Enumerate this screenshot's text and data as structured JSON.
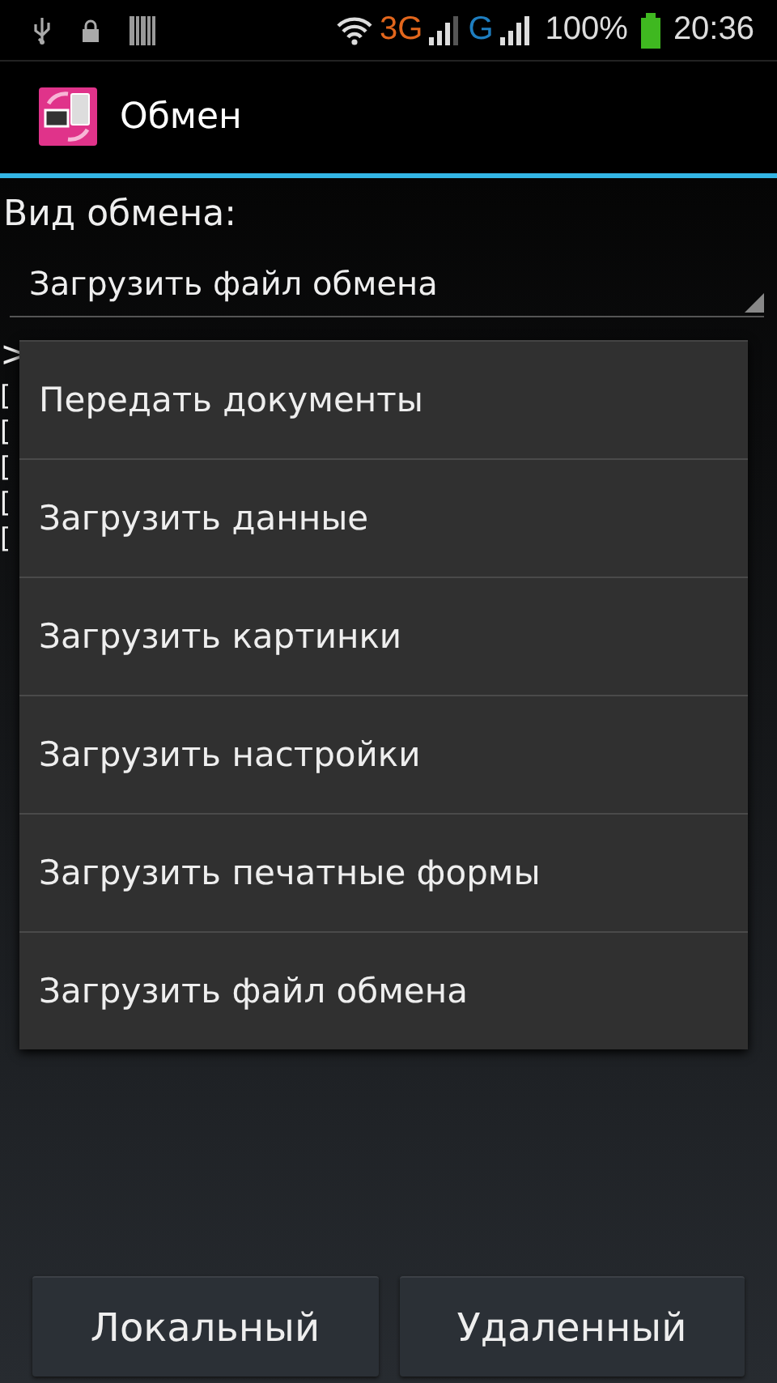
{
  "status_bar": {
    "network_3g": "3G",
    "network_g": "G",
    "battery_percent": "100%",
    "time": "20:36"
  },
  "action_bar": {
    "title": "Обмен"
  },
  "exchange_type": {
    "label": "Вид обмена:",
    "value": "Загрузить файл обмена"
  },
  "log": {
    "header": ">",
    "lines": [
      "[",
      "[",
      "[",
      "[",
      "["
    ]
  },
  "dropdown_menu": {
    "items": [
      {
        "label": "Передать документы"
      },
      {
        "label": "Загрузить данные"
      },
      {
        "label": "Загрузить картинки"
      },
      {
        "label": "Загрузить настройки"
      },
      {
        "label": "Загрузить печатные формы"
      },
      {
        "label": "Загрузить файл обмена"
      }
    ]
  },
  "buttons": [
    {
      "label": "Локальный"
    },
    {
      "label": "Удаленный"
    }
  ]
}
